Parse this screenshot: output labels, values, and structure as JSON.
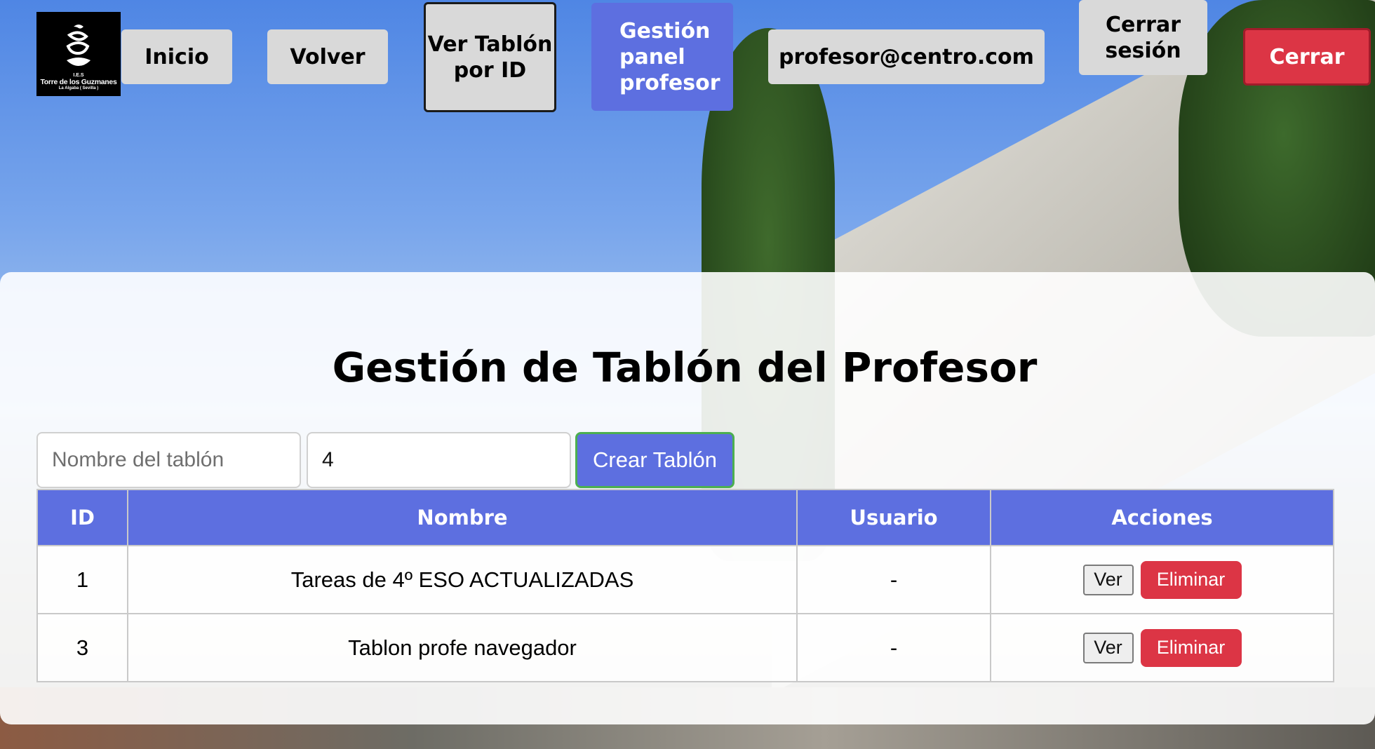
{
  "logo": {
    "line1": "I.E.S",
    "line2": "Torre de los Guzmanes",
    "line3": "La Algaba ( Sevilla )"
  },
  "nav": {
    "inicio": "Inicio",
    "volver": "Volver",
    "tablon_id": "Ver Tablón por ID",
    "gestion": "Gestión panel profesor",
    "email": "profesor@centro.com",
    "logout": "Cerrar sesión",
    "cerrar": "Cerrar"
  },
  "main": {
    "title": "Gestión de Tablón del Profesor",
    "form": {
      "name_placeholder": "Nombre del tablón",
      "name_value": "",
      "user_value": "4",
      "create_label": "Crear Tablón"
    },
    "table": {
      "headers": [
        "ID",
        "Nombre",
        "Usuario",
        "Acciones"
      ],
      "rows": [
        {
          "id": "1",
          "nombre": "Tareas de 4º ESO ACTUALIZADAS",
          "usuario": "-",
          "ver": "Ver",
          "eliminar": "Eliminar"
        },
        {
          "id": "3",
          "nombre": "Tablon profe navegador",
          "usuario": "-",
          "ver": "Ver",
          "eliminar": "Eliminar"
        }
      ]
    }
  },
  "colors": {
    "accent": "#5d6fe0",
    "danger": "#dc3545",
    "focus_border": "#4caf50",
    "nav_button": "#d9d9d9"
  }
}
